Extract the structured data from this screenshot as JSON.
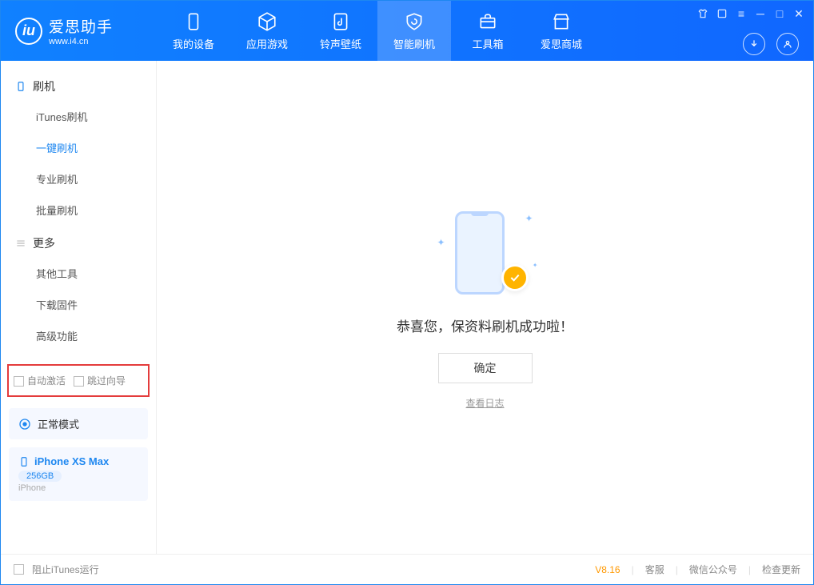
{
  "app": {
    "name": "爱思助手",
    "url": "www.i4.cn"
  },
  "topnav": {
    "items": [
      {
        "label": "我的设备"
      },
      {
        "label": "应用游戏"
      },
      {
        "label": "铃声壁纸"
      },
      {
        "label": "智能刷机"
      },
      {
        "label": "工具箱"
      },
      {
        "label": "爱思商城"
      }
    ]
  },
  "sidebar": {
    "group1": {
      "title": "刷机",
      "items": [
        {
          "label": "iTunes刷机"
        },
        {
          "label": "一键刷机"
        },
        {
          "label": "专业刷机"
        },
        {
          "label": "批量刷机"
        }
      ]
    },
    "group2": {
      "title": "更多",
      "items": [
        {
          "label": "其他工具"
        },
        {
          "label": "下载固件"
        },
        {
          "label": "高级功能"
        }
      ]
    },
    "mode_card": {
      "label": "正常模式"
    },
    "device_card": {
      "name": "iPhone XS Max",
      "storage": "256GB",
      "type": "iPhone"
    },
    "redbox": {
      "opt1": "自动激活",
      "opt2": "跳过向导"
    }
  },
  "main": {
    "message": "恭喜您，保资料刷机成功啦！",
    "ok": "确定",
    "loglink": "查看日志"
  },
  "status": {
    "block_itunes": "阻止iTunes运行",
    "version": "V8.16",
    "links": {
      "kefu": "客服",
      "wechat": "微信公众号",
      "update": "检查更新"
    }
  }
}
